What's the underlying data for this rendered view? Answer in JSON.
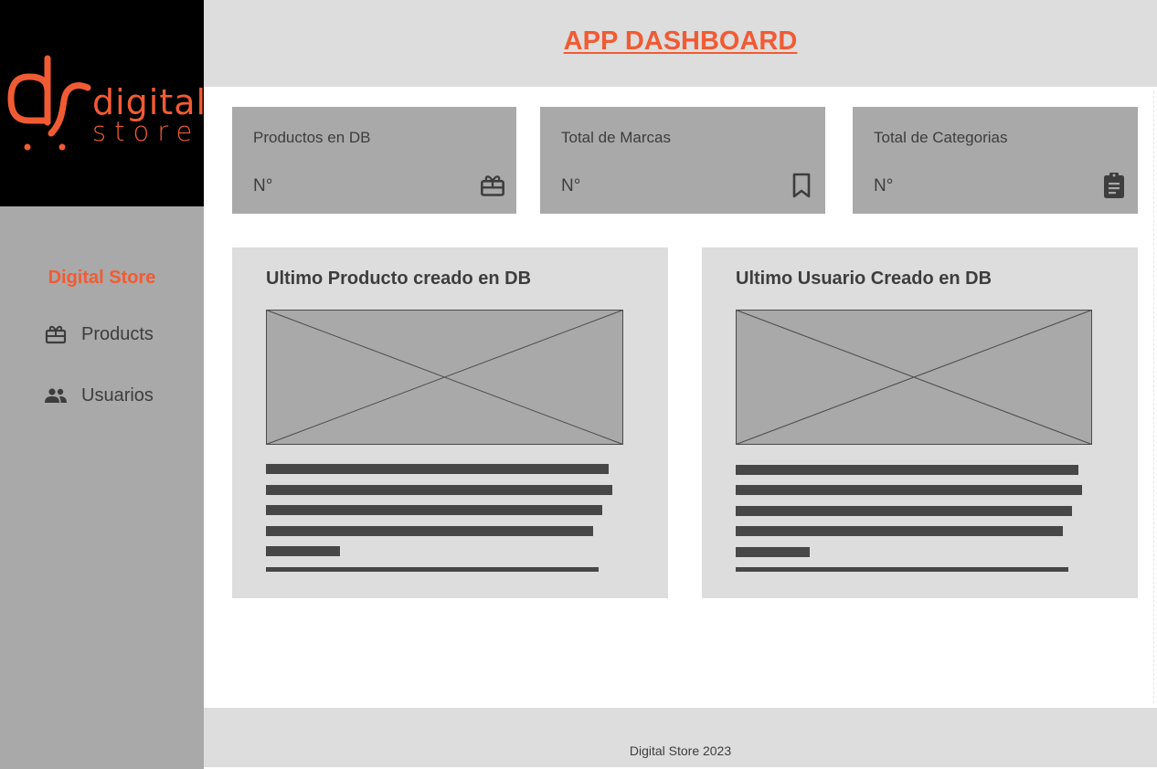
{
  "colors": {
    "accent": "#f15b33",
    "sidebar_bg": "#a9a9a9",
    "header_bg": "#dddddd",
    "card_bg": "#a9a9a9",
    "panel_bg": "#dddddd",
    "text_dark": "#3d3d3d",
    "logo_bg": "#000000"
  },
  "logo": {
    "word_top": "digital",
    "word_bottom": "store"
  },
  "sidebar": {
    "brand": "Digital Store",
    "items": [
      {
        "label": "Products",
        "icon": "gift-box-icon"
      },
      {
        "label": "Usuarios",
        "icon": "users-icon"
      }
    ]
  },
  "header": {
    "title": "APP DASHBOARD"
  },
  "stats": [
    {
      "title": "Productos en DB",
      "value": "N°",
      "icon": "gift-box-icon"
    },
    {
      "title": "Total de Marcas",
      "value": "N°",
      "icon": "bookmark-icon"
    },
    {
      "title": "Total de Categorias",
      "value": "N°",
      "icon": "clipboard-icon"
    }
  ],
  "panels": [
    {
      "title": "Ultimo Producto creado en DB",
      "image": "image-placeholder"
    },
    {
      "title": "Ultimo Usuario Creado en DB",
      "image": "image-placeholder"
    }
  ],
  "footer": {
    "text": "Digital Store 2023"
  }
}
